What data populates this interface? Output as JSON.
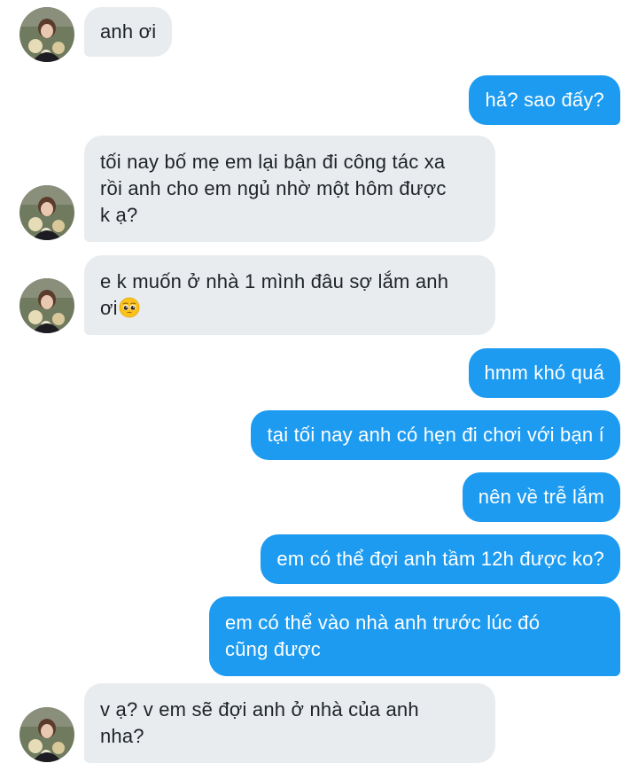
{
  "conversation": {
    "messages": [
      {
        "sender": "them",
        "lines": [
          "anh ơi"
        ],
        "show_avatar": true
      },
      {
        "sender": "me",
        "lines": [
          "hả? sao đấy?"
        ]
      },
      {
        "sender": "them",
        "lines": [
          "tối nay bố mẹ em lại bận đi công tác xa",
          "rồi anh cho em ngủ nhờ một hôm được",
          "k ạ?"
        ],
        "show_avatar": true
      },
      {
        "sender": "them",
        "lines": [
          "e k muốn ở nhà 1 mình đâu sợ lắm anh",
          "ơi"
        ],
        "show_avatar": true,
        "trailing_emoji": "pleading-face-icon"
      },
      {
        "sender": "me",
        "lines": [
          "hmm khó quá"
        ]
      },
      {
        "sender": "me",
        "lines": [
          "tại tối nay anh có hẹn đi chơi với bạn í"
        ]
      },
      {
        "sender": "me",
        "lines": [
          "nên về trễ lắm"
        ]
      },
      {
        "sender": "me",
        "lines": [
          "em có thể đợi anh tầm 12h được ko?"
        ]
      },
      {
        "sender": "me",
        "lines": [
          "em có thể vào nhà anh trước lúc đó",
          "cũng được"
        ]
      },
      {
        "sender": "them",
        "lines": [
          "v ạ? v em sẽ đợi anh ở nhà của anh",
          "nha?"
        ],
        "show_avatar": true
      }
    ]
  },
  "colors": {
    "incoming_bubble": "#e9ecef",
    "outgoing_bubble": "#1d9bf0",
    "incoming_text": "#1e2329",
    "outgoing_text": "#ffffff"
  }
}
